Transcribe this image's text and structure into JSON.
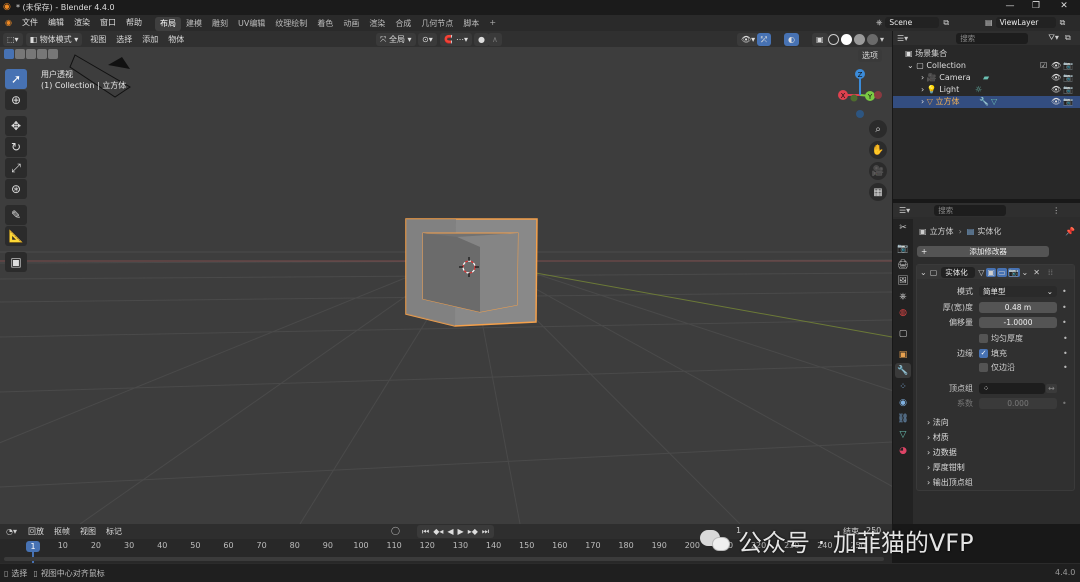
{
  "window": {
    "title": "* (未保存) - Blender 4.4.0",
    "controls": [
      "—",
      "❐",
      "✕"
    ]
  },
  "menu": [
    "文件",
    "编辑",
    "渲染",
    "窗口",
    "帮助"
  ],
  "workspaces": [
    {
      "label": "布局",
      "active": true
    },
    {
      "label": "建模",
      "active": false
    },
    {
      "label": "雕刻",
      "active": false
    },
    {
      "label": "UV编辑",
      "active": false
    },
    {
      "label": "纹理绘制",
      "active": false
    },
    {
      "label": "着色",
      "active": false
    },
    {
      "label": "动画",
      "active": false
    },
    {
      "label": "渲染",
      "active": false
    },
    {
      "label": "合成",
      "active": false
    },
    {
      "label": "几何节点",
      "active": false
    },
    {
      "label": "脚本",
      "active": false
    }
  ],
  "scene": {
    "scene_name": "Scene",
    "view_layer": "ViewLayer"
  },
  "viewport_header": {
    "mode": "物体模式",
    "menus": [
      "视图",
      "选择",
      "添加",
      "物体"
    ],
    "transform_orientation": "全局",
    "options_label": "选项"
  },
  "viewport": {
    "view_name": "用户透视",
    "view_context": "(1) Collection | 立方体",
    "gizmo_axes": [
      "X",
      "Y",
      "Z"
    ]
  },
  "outliner": {
    "search_placeholder": "搜索",
    "root": "场景集合",
    "collection": "Collection",
    "items": [
      {
        "name": "Camera",
        "selected": false
      },
      {
        "name": "Light",
        "selected": false
      },
      {
        "name": "立方体",
        "selected": true
      }
    ]
  },
  "properties": {
    "search_placeholder": "搜索",
    "breadcrumb_object": "立方体",
    "breadcrumb_modifier": "实体化",
    "add_modifier": "添加修改器",
    "modifier_name": "实体化",
    "fields": {
      "mode_label": "模式",
      "mode_value": "简单型",
      "thickness_label": "厚(宽)度",
      "thickness_value": "0.48 m",
      "offset_label": "偏移量",
      "offset_value": "-1.0000",
      "even_thickness": "均匀厚度",
      "rim_label": "边缘",
      "rim_fill": "填充",
      "rim_only": "仅边沿",
      "vgroup_label": "顶点组",
      "factor_label": "系数",
      "factor_value": "0.000"
    },
    "subpanels": [
      "法向",
      "材质",
      "边数据",
      "厚度钳制",
      "输出顶点组"
    ]
  },
  "timeline": {
    "menus": [
      "回放",
      "抠帧",
      "视图",
      "标记"
    ],
    "current_frame": "1",
    "start_frame_value": "1",
    "end_label": "结束",
    "end_value": "250",
    "ticks": [
      "1",
      "10",
      "20",
      "30",
      "40",
      "50",
      "60",
      "70",
      "80",
      "90",
      "100",
      "110",
      "120",
      "130",
      "140",
      "150",
      "160",
      "170",
      "180",
      "190",
      "200",
      "210",
      "220",
      "230",
      "240",
      "250"
    ]
  },
  "statusbar": {
    "select": "选择",
    "view_hint": "视图中心对齐鼠标",
    "version": "4.4.0"
  },
  "watermark": "公众号 · 加菲猫的VFP",
  "colors": {
    "accent": "#4772b3",
    "selection_outline": "#f5a04a",
    "axis_x": "#e0414f",
    "axis_y": "#7ac943",
    "axis_z": "#3b8bd9",
    "viewport_bg": "#3d3d3d"
  }
}
